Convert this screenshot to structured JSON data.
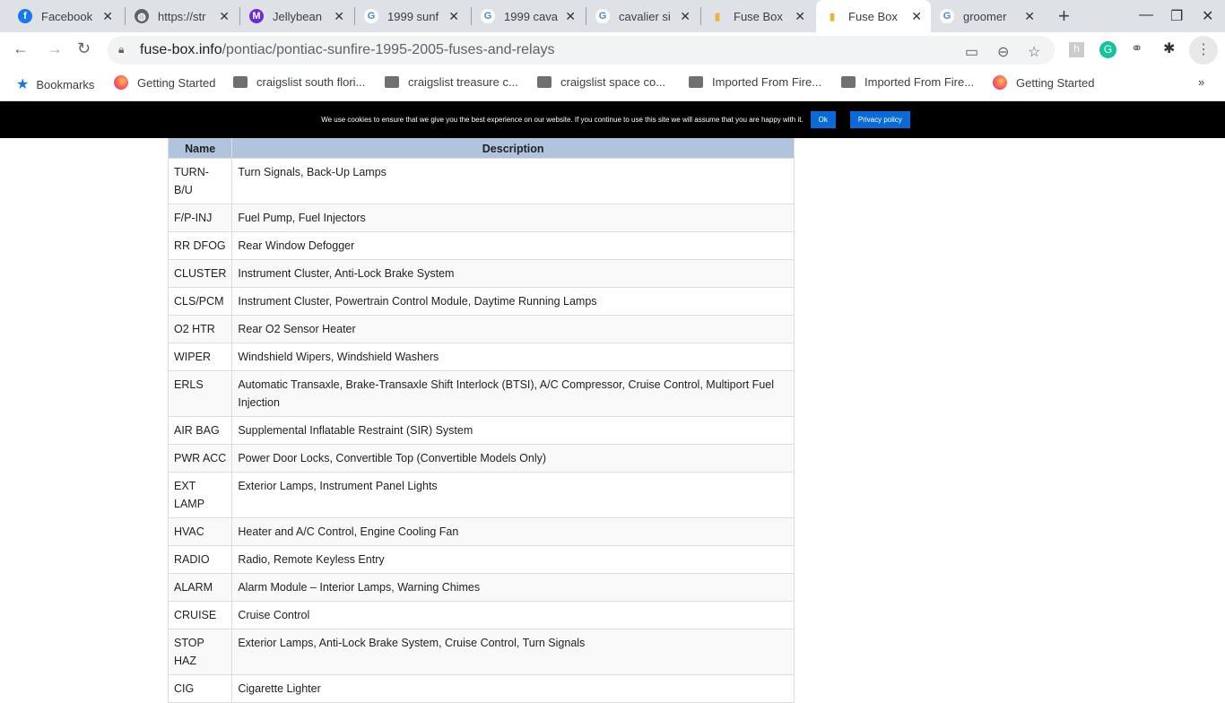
{
  "tabs": [
    {
      "title": "Facebook",
      "icon": "facebook-icon",
      "color": "#1877f2",
      "glyph": "f"
    },
    {
      "title": "https://str",
      "icon": "globe-icon",
      "color": "#5f6368",
      "glyph": "◍"
    },
    {
      "title": "Jellybean",
      "icon": "jellybean-m-icon",
      "color": "#6c2bd9",
      "glyph": "M"
    },
    {
      "title": "1999 sunf",
      "icon": "google-icon",
      "color": "#fff",
      "glyph": "G"
    },
    {
      "title": "1999 cava",
      "icon": "google-icon",
      "color": "#fff",
      "glyph": "G"
    },
    {
      "title": "cavalier si",
      "icon": "google-icon",
      "color": "#fff",
      "glyph": "G"
    },
    {
      "title": "Fuse Box",
      "icon": "fuse-icon",
      "color": "#f0b030",
      "glyph": "▮"
    },
    {
      "title": "Fuse Box",
      "icon": "fuse-icon",
      "color": "#f0b030",
      "glyph": "▮",
      "active": true
    },
    {
      "title": "groomer",
      "icon": "google-icon",
      "color": "#fff",
      "glyph": "G"
    }
  ],
  "url": {
    "domain": "fuse-box.info",
    "path": "/pontiac/pontiac-sunfire-1995-2005-fuses-and-relays"
  },
  "bookmarks": [
    {
      "label": "Bookmarks",
      "type": "star"
    },
    {
      "label": "Getting Started",
      "type": "firefox"
    },
    {
      "label": "craigslist south flori...",
      "type": "folder"
    },
    {
      "label": "craigslist treasure c...",
      "type": "folder"
    },
    {
      "label": "craigslist space co...",
      "type": "folder"
    },
    {
      "label": "Imported From Fire...",
      "type": "folder"
    },
    {
      "label": "Imported From Fire...",
      "type": "folder"
    },
    {
      "label": "Getting Started",
      "type": "firefox"
    }
  ],
  "cookie": {
    "text": "We use cookies to ensure that we give you the best experience on our website. If you continue to use this site we will assume that you are happy with it.",
    "ok": "Ok",
    "privacy": "Privacy policy"
  },
  "table": {
    "headers": [
      "Name",
      "Description"
    ],
    "rows": [
      [
        "TURN-B/U",
        "Turn Signals, Back-Up Lamps"
      ],
      [
        "F/P-INJ",
        "Fuel Pump, Fuel Injectors"
      ],
      [
        "RR DFOG",
        "Rear Window Defogger"
      ],
      [
        "CLUSTER",
        "Instrument Cluster, Anti-Lock Brake System"
      ],
      [
        "CLS/PCM",
        "Instrument Cluster, Powertrain Control Module, Daytime Running Lamps"
      ],
      [
        "O2 HTR",
        "Rear O2 Sensor Heater"
      ],
      [
        "WIPER",
        "Windshield Wipers, Windshield Washers"
      ],
      [
        "ERLS",
        "Automatic Transaxle, Brake-Transaxle Shift Interlock (BTSI), A/C Compressor, Cruise Control, Multiport Fuel Injection"
      ],
      [
        "AIR BAG",
        "Supplemental Inflatable Restraint (SIR) System"
      ],
      [
        "PWR ACC",
        "Power Door Locks, Convertible Top (Convertible Models Only)"
      ],
      [
        "EXT LAMP",
        "Exterior Lamps, Instrument Panel Lights"
      ],
      [
        "HVAC",
        "Heater and A/C Control, Engine Cooling Fan"
      ],
      [
        "RADIO",
        "Radio, Remote Keyless Entry"
      ],
      [
        "ALARM",
        "Alarm Module – Interior Lamps, Warning Chimes"
      ],
      [
        "CRUISE",
        "Cruise Control"
      ],
      [
        "STOP HAZ",
        "Exterior Lamps, Anti-Lock Brake System, Cruise Control, Turn Signals"
      ],
      [
        "CIG",
        "Cigarette Lighter"
      ]
    ]
  }
}
